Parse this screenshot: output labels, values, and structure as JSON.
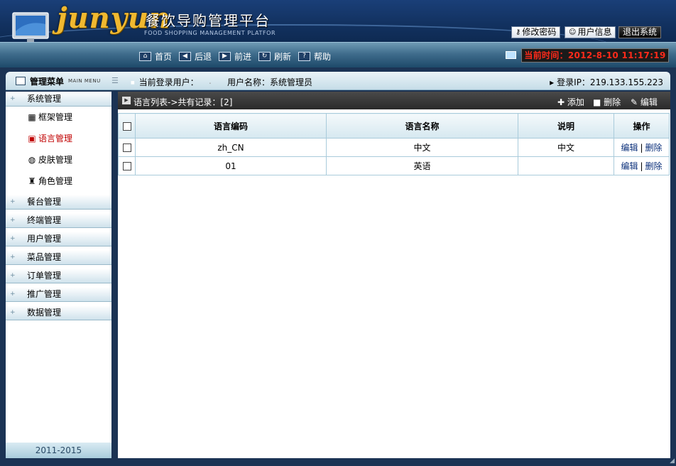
{
  "header": {
    "logo_text": "junyun",
    "app_title": "餐饮导购管理平台",
    "app_subtitle": "FOOD SHOPPING MANAGEMENT PLATFOR",
    "buttons": {
      "change_password": "修改密码",
      "user_info": "用户信息",
      "logout": "退出系统"
    }
  },
  "toolbar": {
    "home": "首页",
    "back": "后退",
    "forward": "前进",
    "refresh": "刷新",
    "help": "帮助",
    "time": "当前时间：2012-8-10 11:17:19"
  },
  "infobar": {
    "menu_title": "管理菜单",
    "menu_subtitle": "MAIN MENU",
    "current_user_label": "当前登录用户：",
    "current_user_value": ".",
    "username_label": "用户名称：系统管理员",
    "login_ip": "登录IP：219.133.155.223"
  },
  "sidebar": {
    "groups": [
      {
        "label": "系统管理"
      },
      {
        "label": "餐台管理"
      },
      {
        "label": "终端管理"
      },
      {
        "label": "用户管理"
      },
      {
        "label": "菜品管理"
      },
      {
        "label": "订单管理"
      },
      {
        "label": "推广管理"
      },
      {
        "label": "数据管理"
      }
    ],
    "sub_items": [
      {
        "label": "框架管理"
      },
      {
        "label": "语言管理"
      },
      {
        "label": "皮肤管理"
      },
      {
        "label": "角色管理"
      }
    ],
    "footer": "2011-2015"
  },
  "main": {
    "list_title": "语言列表->共有记录：[2]",
    "actions": {
      "add": "添加",
      "delete": "删除",
      "edit": "编辑"
    },
    "columns": [
      "语言编码",
      "语言名称",
      "说明",
      "操作"
    ],
    "rows": [
      {
        "code": "zh_CN",
        "name": "中文",
        "desc": "中文",
        "edit": "编辑",
        "delete": "删除"
      },
      {
        "code": "01",
        "name": "英语",
        "desc": "",
        "edit": "编辑",
        "delete": "删除"
      }
    ]
  },
  "colors": {
    "header_bg": "#12315f",
    "logo_gold": "#f0b830",
    "time_red": "#ff2a1a",
    "active_menu": "#c00000",
    "table_border": "#a9cbdb"
  }
}
